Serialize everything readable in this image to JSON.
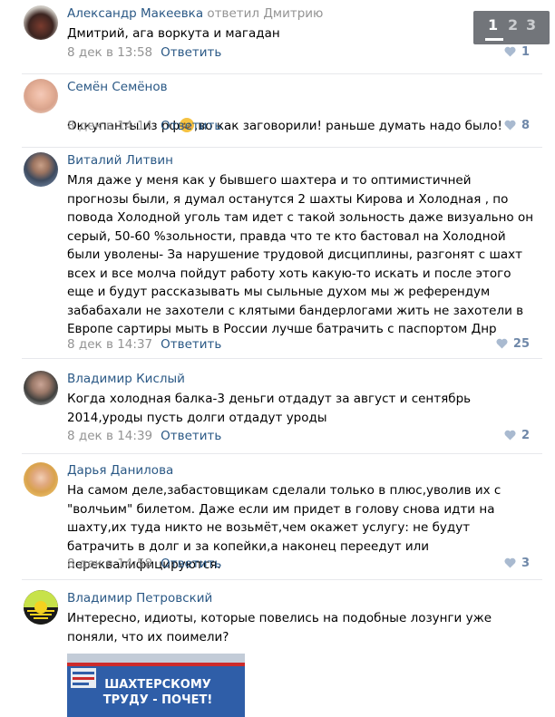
{
  "comments": [
    {
      "author": "Александр Макеевка",
      "replied": "ответил Дмитрию",
      "text": "Дмитрий, ага воркута и магадан",
      "date": "8 дек в 13:58",
      "reply_label": "Ответить",
      "likes": "1"
    },
    {
      "author": "Семён Семёнов",
      "text_before_emoji": "Оккупанты из рф",
      "text_after_emoji": ",во как заговорили! раньше думать надо было!",
      "date": "8 дек в 14:14",
      "reply_label": "Ответить",
      "likes": "8"
    },
    {
      "author": "Виталий Литвин",
      "text": "Мля даже у меня как у бывшего шахтера и то оптимистичней прогнозы были, я думал останутся 2 шахты Кирова и Холодная , по повода Холодной уголь там идет с такой зольность даже визуально он серый, 50-60 %зольности, правда что те кто бастовал на Холодной были уволены- За нарушение трудовой дисциплины, разгонят с шахт всех и все молча пойдут работу хоть какую-то искать и после этого еще и будут рассказывать мы сыльные духом мы ж референдум забабахали не захотели с клятыми бандерлогами жить не захотели в Европе сартиры мыть в России лучше батрачить с паспортом Днр",
      "date": "8 дек в 14:37",
      "reply_label": "Ответить",
      "likes": "25"
    },
    {
      "author": "Владимир Кислый",
      "text": "Когда холодная балка-3 деньги отдадут за август и сентябрь 2014,уроды пусть долги отдадут уроды",
      "date": "8 дек в 14:39",
      "reply_label": "Ответить",
      "likes": "2"
    },
    {
      "author": "Дарья Данилова",
      "text": "На самом деле,забастовщикам сделали только в плюс,уволив их с \"волчьим\" билетом. Даже если им придет в голову снова идти на шахту,их туда никто не возьмёт,чем окажет услугу: не будут батрачить в долг и за копейки,а наконец переедут или переквалифицируются.",
      "date": "8 дек в 14:58",
      "reply_label": "Ответить",
      "likes": "3"
    },
    {
      "author": "Владимир Петровский",
      "text": "Интересно, идиоты, которые повелись на подобные лозунги уже поняли, что их поимели?",
      "photo_text_line1": "ШАХТЕРСКОМУ",
      "photo_text_line2": "ТРУДУ - ПОЧЕТ!"
    }
  ],
  "pager": {
    "pages": [
      "1",
      "2",
      "3"
    ],
    "current": "1"
  },
  "colors": {
    "link": "#2a5885",
    "muted": "#939393",
    "likes": "#6f88a9",
    "separator": "#e7e8ec"
  }
}
